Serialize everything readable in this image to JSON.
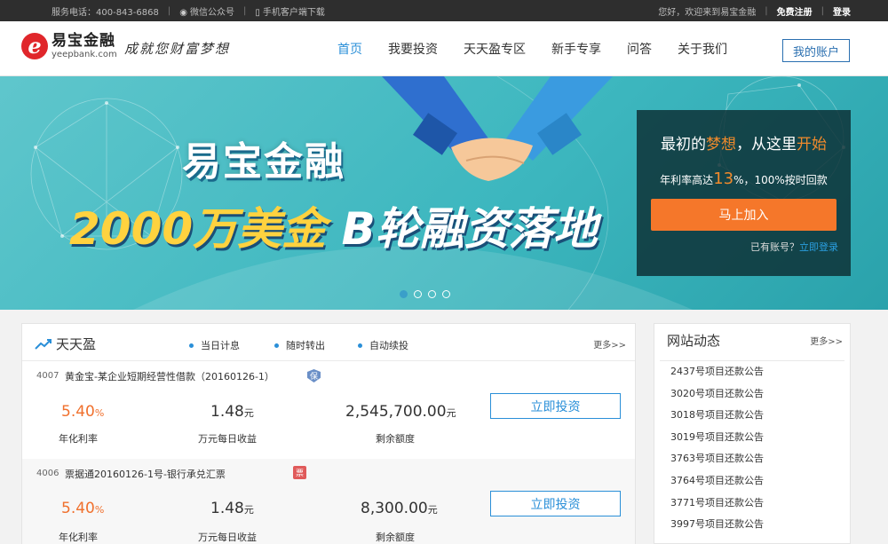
{
  "topbar": {
    "phone": "服务电话：400-843-6868",
    "wechat": "微信公众号",
    "mobile": "手机客户端下载",
    "greeting": "您好，欢迎来到易宝金融",
    "register": "免费注册",
    "login": "登录"
  },
  "header": {
    "logo_cn": "易宝金融",
    "logo_en": "yeepbank.com",
    "logo_mark": "e",
    "slogan": "成就您财富梦想",
    "nav": [
      "首页",
      "我要投资",
      "天天盈专区",
      "新手专享",
      "问答",
      "关于我们"
    ],
    "active_nav": 0,
    "account": "我的账户"
  },
  "banner": {
    "title_line1": "易宝金融",
    "title_line2_gold": "2000万美金",
    "title_line2_white": " B轮融资落地",
    "slide_count": 4,
    "active_slide": 0
  },
  "panel": {
    "title_a": "最初的",
    "title_b": "梦想",
    "title_c": "，从这里",
    "title_d": "开始",
    "sub_a": "年利率高达",
    "sub_rate": "13",
    "sub_b": "%，100%按时回款",
    "join": "马上加入",
    "have_account": "已有账号？",
    "login_now": "立即登录"
  },
  "product_card": {
    "title": "天天盈",
    "features": [
      "当日计息",
      "随时转出",
      "自动续投"
    ],
    "more": "更多>>",
    "labels": {
      "rate": "年化利率",
      "income": "万元每日收益",
      "remain": "剩余额度"
    },
    "invest_label": "立即投资",
    "rows": [
      {
        "id": "4007",
        "name": "黄金宝-某企业短期经营性借款（20160126-1）",
        "badge": "保",
        "rate": "5.40",
        "rate_unit": "%",
        "income": "1.48",
        "income_unit": "元",
        "remain": "2,545,700.00",
        "remain_unit": "元"
      },
      {
        "id": "4006",
        "name": "票据通20160126-1号-银行承兑汇票",
        "badge": "票",
        "rate": "5.40",
        "rate_unit": "%",
        "income": "1.48",
        "income_unit": "元",
        "remain": "8,300.00",
        "remain_unit": "元"
      }
    ]
  },
  "news": {
    "title": "网站动态",
    "more": "更多>>",
    "items": [
      "2437号项目还款公告",
      "3020号项目还款公告",
      "3018号项目还款公告",
      "3019号项目还款公告",
      "3763号项目还款公告",
      "3764号项目还款公告",
      "3771号项目还款公告",
      "3997号项目还款公告"
    ]
  },
  "colors": {
    "brand_red": "#e0262b",
    "nav_active": "#2a8fd8",
    "accent_orange": "#f5772a",
    "banner_teal": "#3db7bf"
  }
}
